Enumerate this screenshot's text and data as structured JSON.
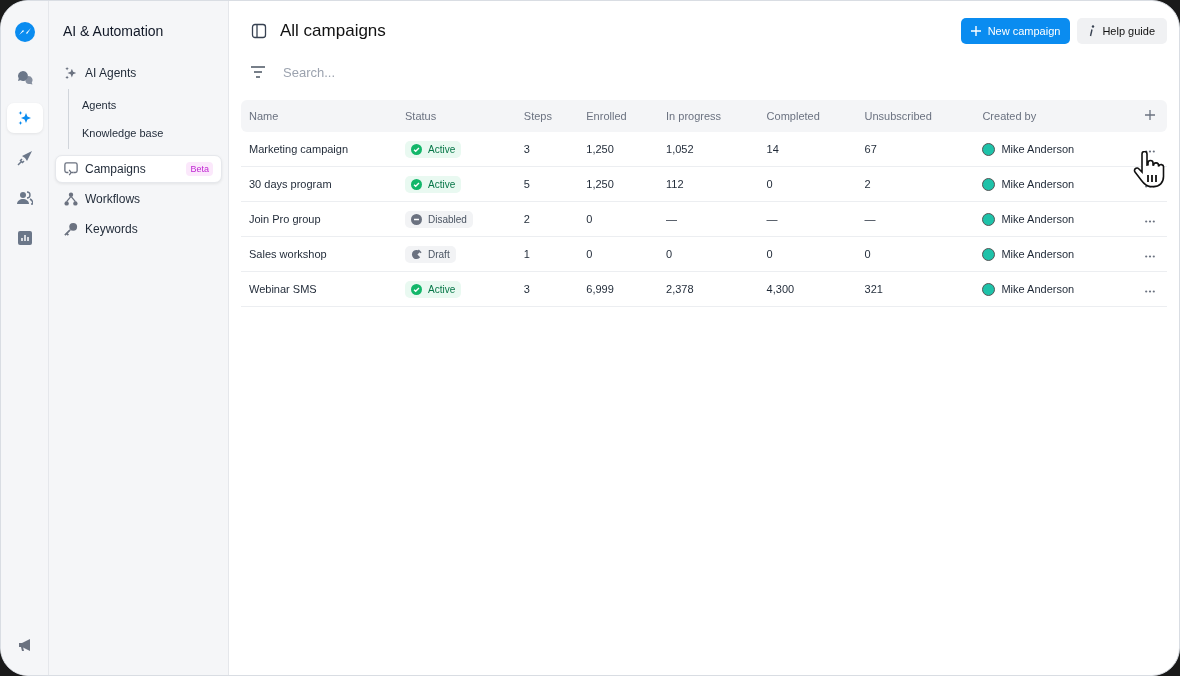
{
  "rail": {
    "items": [
      {
        "kind": "chat",
        "selected": false
      },
      {
        "kind": "sparkle",
        "selected": true
      },
      {
        "kind": "send",
        "selected": false
      },
      {
        "kind": "users",
        "selected": false
      },
      {
        "kind": "chart",
        "selected": false
      }
    ]
  },
  "sidebar": {
    "title": "AI & Automation",
    "items": [
      {
        "label": "AI Agents",
        "kind": "sparkle",
        "selected": false,
        "children": [
          {
            "label": "Agents",
            "selected": false
          },
          {
            "label": "Knowledge base",
            "selected": false
          }
        ]
      },
      {
        "label": "Campaigns",
        "kind": "campaign",
        "selected": true,
        "badge": "Beta"
      },
      {
        "label": "Workflows",
        "kind": "workflow",
        "selected": false
      },
      {
        "label": "Keywords",
        "kind": "key",
        "selected": false
      }
    ]
  },
  "header": {
    "title": "All campaigns",
    "buttons": [
      {
        "label": "New campaign",
        "kind": "primary"
      },
      {
        "label": "Help guide",
        "kind": "secondary"
      }
    ]
  },
  "search": {
    "placeholder": "Search..."
  },
  "table": {
    "columns": [
      "Name",
      "Status",
      "Steps",
      "Enrolled",
      "In progress",
      "Completed",
      "Unsubscribed",
      "Created by"
    ],
    "rows": [
      {
        "name": "Marketing campaign",
        "status": {
          "label": "Active",
          "kind": "active"
        },
        "steps": "3",
        "enrolled": "1,250",
        "in_progress": "1,052",
        "completed": "14",
        "unsubscribed": "67",
        "created_by": "Mike Anderson"
      },
      {
        "name": "30 days program",
        "status": {
          "label": "Active",
          "kind": "active"
        },
        "steps": "5",
        "enrolled": "1,250",
        "in_progress": "112",
        "completed": "0",
        "unsubscribed": "2",
        "created_by": "Mike Anderson"
      },
      {
        "name": "Join Pro group",
        "status": {
          "label": "Disabled",
          "kind": "disabled"
        },
        "steps": "2",
        "enrolled": "0",
        "in_progress": "—",
        "completed": "—",
        "unsubscribed": "—",
        "created_by": "Mike Anderson"
      },
      {
        "name": "Sales workshop",
        "status": {
          "label": "Draft",
          "kind": "draft"
        },
        "steps": "1",
        "enrolled": "0",
        "in_progress": "0",
        "completed": "0",
        "unsubscribed": "0",
        "created_by": "Mike Anderson"
      },
      {
        "name": "Webinar SMS",
        "status": {
          "label": "Active",
          "kind": "active"
        },
        "steps": "3",
        "enrolled": "6,999",
        "in_progress": "2,378",
        "completed": "4,300",
        "unsubscribed": "321",
        "created_by": "Mike Anderson"
      }
    ]
  }
}
